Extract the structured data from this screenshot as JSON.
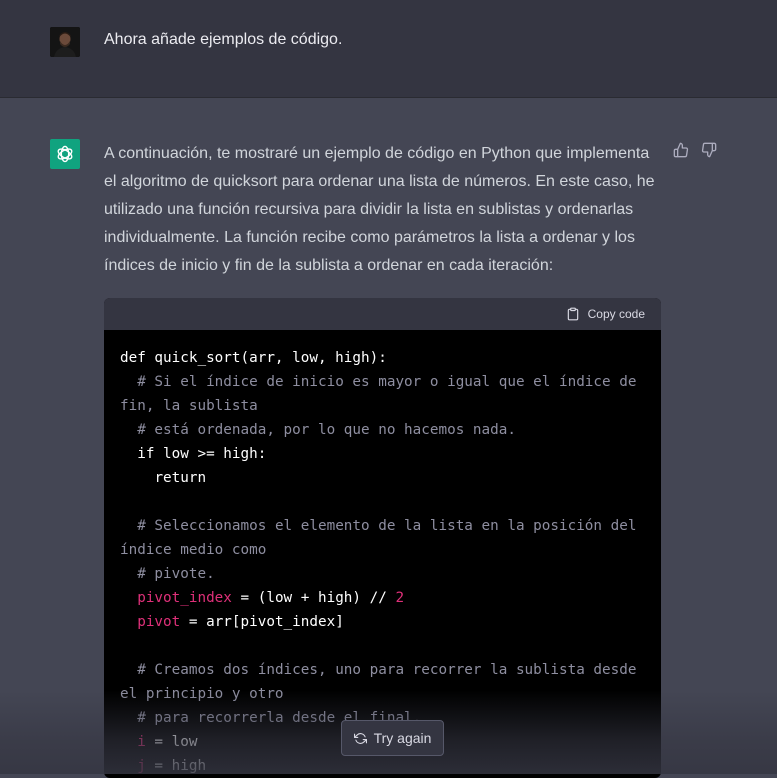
{
  "user_message": {
    "text": "Ahora añade ejemplos de código."
  },
  "assistant_message": {
    "text": "A continuación, te mostraré un ejemplo de código en Python que implementa el algoritmo de quicksort para ordenar una lista de números. En este caso, he utilizado una función recursiva para dividir la lista en sublistas y ordenarlas individualmente. La función recibe como parámetros la lista a ordenar y los índices de inicio y fin de la sublista a ordenar en cada iteración:"
  },
  "code_block": {
    "copy_label": "Copy code",
    "lines": {
      "l1": "def quick_sort(arr, low, high):",
      "l2": "  # Si el índice de inicio es mayor o igual que el índice de fin, la sublista",
      "l3": "  # está ordenada, por lo que no hacemos nada.",
      "l4": "  if low >= high:",
      "l5": "    return",
      "l6": "  # Seleccionamos el elemento de la lista en la posición del índice medio como",
      "l7": "  # pivote.",
      "l8_var": "pivot_index",
      "l8_rest": " = (low + high) // ",
      "l8_num": "2",
      "l9_var": "pivot",
      "l9_rest": " = arr[pivot_index]",
      "l10": "  # Creamos dos índices, uno para recorrer la sublista desde el principio y otro",
      "l11": "  # para recorrerla desde el final.",
      "l12_var": "i",
      "l12_rest": " = low",
      "l13_var": "j",
      "l13_rest": " = high"
    }
  },
  "try_again": {
    "label": "Try again"
  },
  "icons": {
    "gpt_logo": "openai-logo-icon",
    "thumbs_up": "thumbs-up-icon",
    "thumbs_down": "thumbs-down-icon",
    "clipboard": "clipboard-icon",
    "refresh": "refresh-icon"
  },
  "colors": {
    "user_bg": "#343541",
    "assistant_bg": "#444654",
    "brand_green": "#10a37f",
    "code_bg": "#000000",
    "code_var": "#df3079"
  }
}
